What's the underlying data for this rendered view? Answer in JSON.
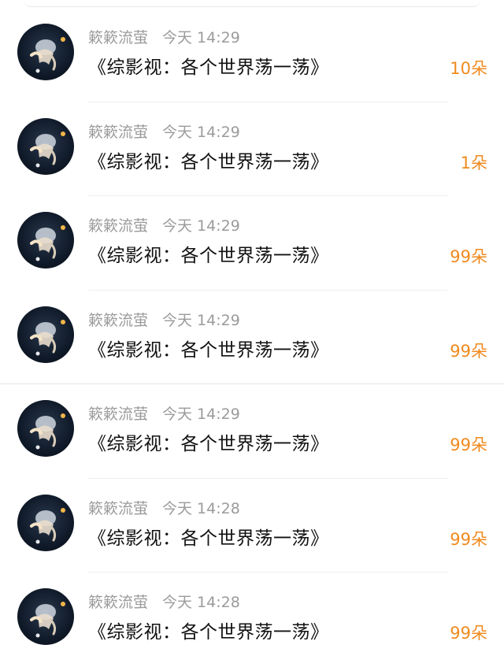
{
  "items": [
    {
      "user": "簌簌流萤",
      "time": "今天 14:29",
      "title": "《综影视：各个世界荡一荡》",
      "count": "10朵"
    },
    {
      "user": "簌簌流萤",
      "time": "今天 14:29",
      "title": "《综影视：各个世界荡一荡》",
      "count": "1朵"
    },
    {
      "user": "簌簌流萤",
      "time": "今天 14:29",
      "title": "《综影视：各个世界荡一荡》",
      "count": "99朵"
    },
    {
      "user": "簌簌流萤",
      "time": "今天 14:29",
      "title": "《综影视：各个世界荡一荡》",
      "count": "99朵"
    },
    {
      "user": "簌簌流萤",
      "time": "今天 14:29",
      "title": "《综影视：各个世界荡一荡》",
      "count": "99朵"
    },
    {
      "user": "簌簌流萤",
      "time": "今天 14:28",
      "title": "《综影视：各个世界荡一荡》",
      "count": "99朵"
    },
    {
      "user": "簌簌流萤",
      "time": "今天 14:28",
      "title": "《综影视：各个世界荡一荡》",
      "count": "99朵"
    }
  ],
  "colors": {
    "count_accent": "#f08a1e",
    "meta_gray": "#9b9b9b",
    "title_text": "#111111"
  }
}
